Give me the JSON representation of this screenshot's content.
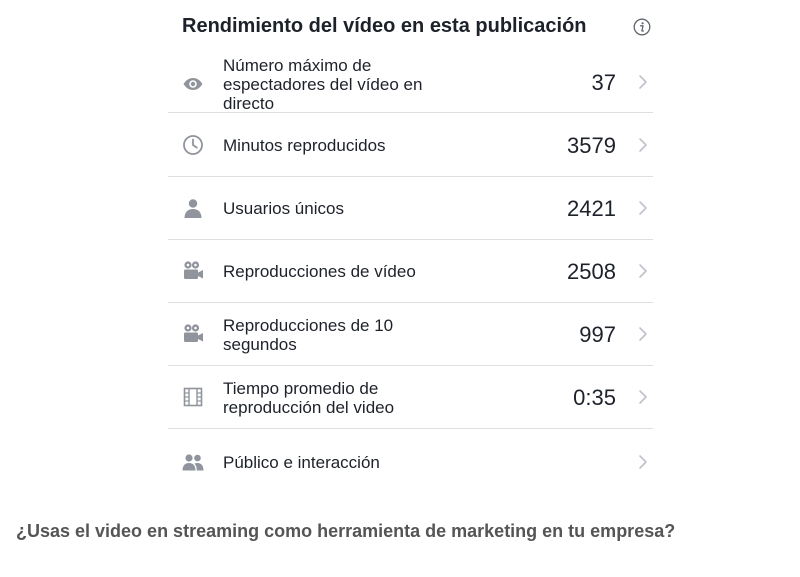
{
  "panel": {
    "title": "Rendimiento del vídeo en esta publicación",
    "info_icon": "info-circle-icon"
  },
  "metrics": [
    {
      "icon": "eye-icon",
      "label_lines": [
        "Número máximo de",
        "espectadores del vídeo en",
        "directo"
      ],
      "value": "37"
    },
    {
      "icon": "clock-icon",
      "label_lines": [
        "Minutos reproducidos"
      ],
      "value": "3579"
    },
    {
      "icon": "person-icon",
      "label_lines": [
        "Usuarios únicos"
      ],
      "value": "2421"
    },
    {
      "icon": "video-camera-icon",
      "label_lines": [
        "Reproducciones de vídeo"
      ],
      "value": "2508"
    },
    {
      "icon": "video-camera-icon",
      "label_lines": [
        "Reproducciones de 10",
        "segundos"
      ],
      "value": "997"
    },
    {
      "icon": "film-strip-icon",
      "label_lines": [
        "Tiempo promedio de",
        "reproducción del video"
      ],
      "value": "0:35"
    },
    {
      "icon": "people-icon",
      "label_lines": [
        "Público e interacción"
      ],
      "value": ""
    }
  ],
  "footer": {
    "question": "¿Usas el video en streaming como herramienta de marketing en tu empresa?"
  },
  "colors": {
    "text": "#1d2129",
    "icon": "#90949c",
    "divider": "#dddfe2",
    "chevron": "#bec2c9",
    "question": "#555555"
  }
}
